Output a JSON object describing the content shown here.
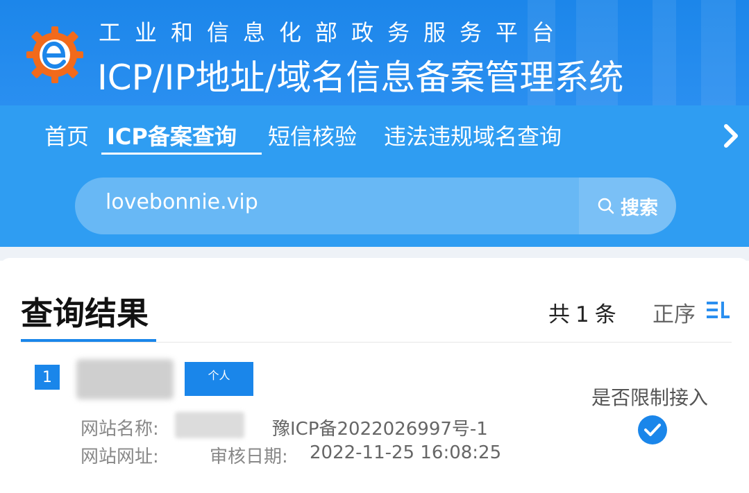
{
  "colors": {
    "brand_blue": "#1c86ea",
    "band_blue": "#2f9df2",
    "accent_blue": "#1a86ea"
  },
  "header": {
    "sub_title": "工业和信息化部政务服务平台",
    "main_title": "ICP/IP地址/域名信息备案管理系统",
    "logo_icon": "gear-e-logo"
  },
  "nav": {
    "items": [
      {
        "label": "首页",
        "active": false
      },
      {
        "label": "ICP备案查询",
        "active": true
      },
      {
        "label": "短信核验",
        "active": false
      },
      {
        "label": "违法违规域名查询",
        "active": false
      }
    ],
    "next_icon": "chevron-right-icon"
  },
  "search": {
    "value": "lovebonnie.vip",
    "button_label": "搜索",
    "button_icon": "search-icon"
  },
  "results": {
    "title": "查询结果",
    "count_prefix": "共",
    "count": "1",
    "count_suffix": "条",
    "sort_label": "正序",
    "sort_icon": "sort-icon",
    "items": [
      {
        "index": "1",
        "type": "个人",
        "restrict_label": "是否限制接入",
        "site_name_label": "网站名称:",
        "license": "豫ICP备2022026997号-1",
        "site_url_label": "网站网址:",
        "audit_date_label": "审核日期:",
        "audit_date": "2022-11-25 16:08:25",
        "restrict_icon": "check-circle-icon"
      }
    ]
  }
}
